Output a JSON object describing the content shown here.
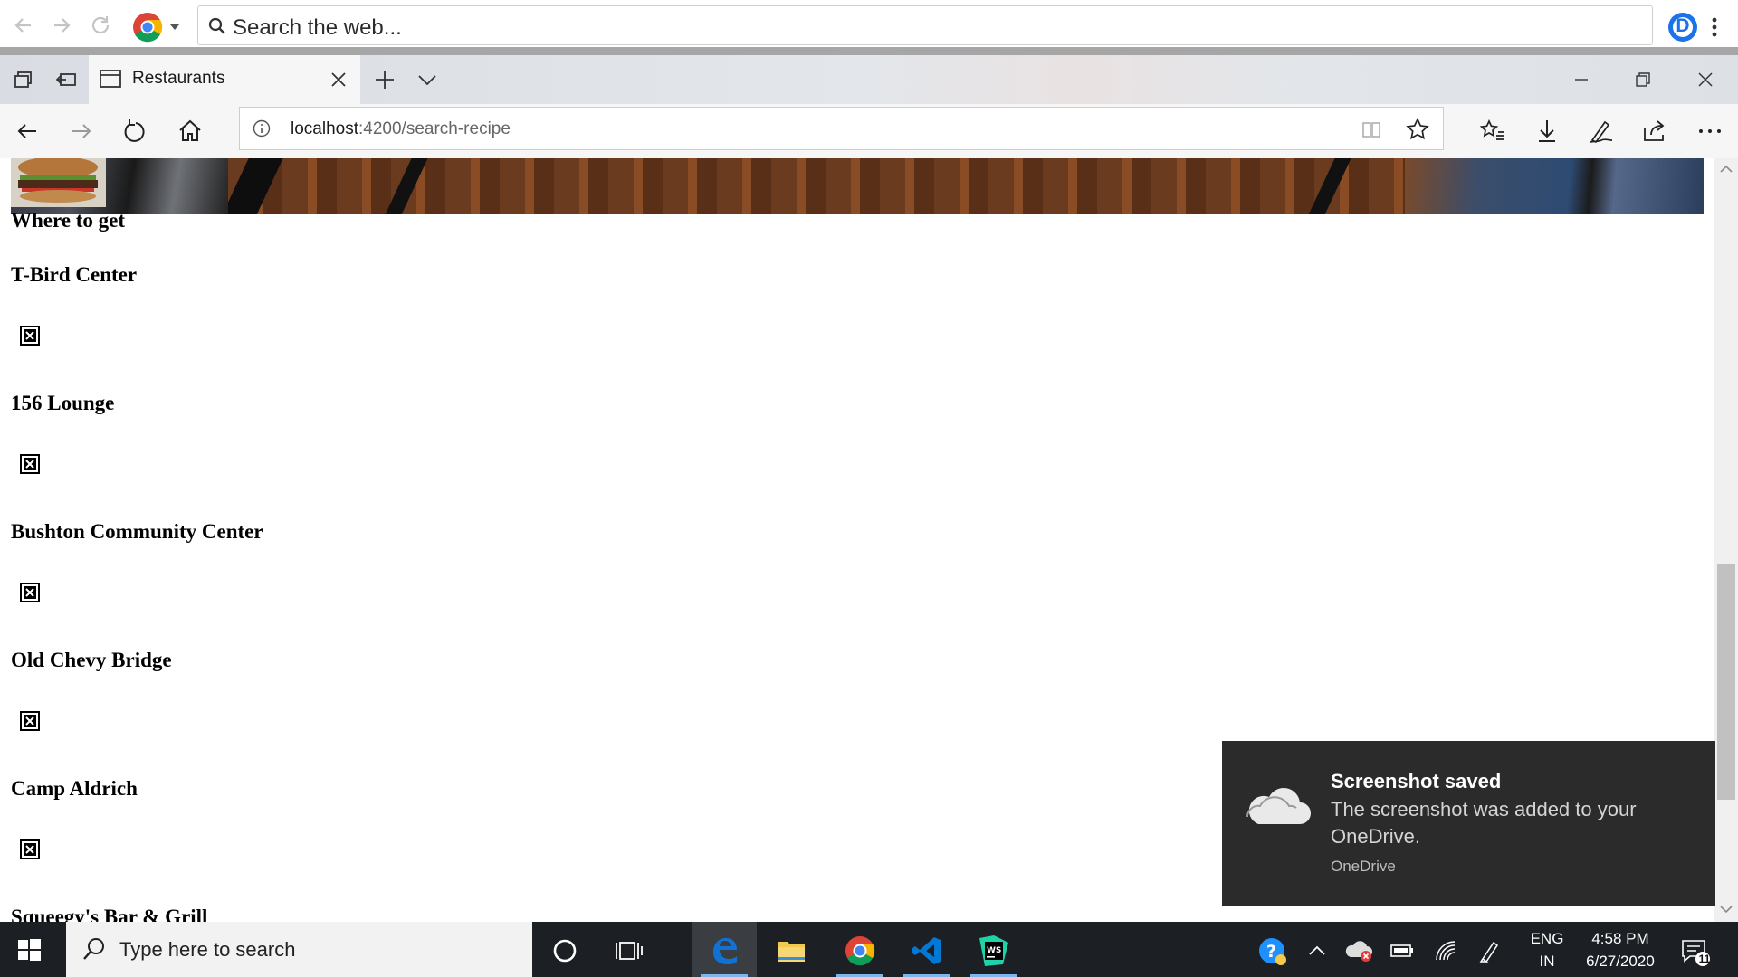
{
  "outer_browser": {
    "search_placeholder": "Search the web...",
    "profile_initial": "D"
  },
  "tab": {
    "title": "Restaurants"
  },
  "address_bar": {
    "host": "localhost",
    "path": ":4200/search-recipe"
  },
  "page": {
    "heading": "Where to get",
    "places": [
      {
        "name": "T-Bird Center"
      },
      {
        "name": "156 Lounge"
      },
      {
        "name": "Bushton Community Center"
      },
      {
        "name": "Old Chevy Bridge"
      },
      {
        "name": "Camp Aldrich"
      },
      {
        "name": "Squeegy's Bar & Grill"
      }
    ]
  },
  "toast": {
    "title": "Screenshot saved",
    "body": "The screenshot was added to your OneDrive.",
    "app": "OneDrive"
  },
  "taskbar": {
    "search_placeholder": "Type here to search",
    "language_top": "ENG",
    "language_bottom": "IN",
    "time": "4:58 PM",
    "date": "6/27/2020",
    "notification_count": "11"
  },
  "colors": {
    "taskbar_bg": "#1c1f23",
    "toast_bg": "#2b2b2b",
    "edge_blue": "#1172d4",
    "chrome_red": "#db4437",
    "chrome_green": "#0f9d58",
    "chrome_yellow": "#f4b400",
    "vscode_blue": "#0078d4"
  }
}
